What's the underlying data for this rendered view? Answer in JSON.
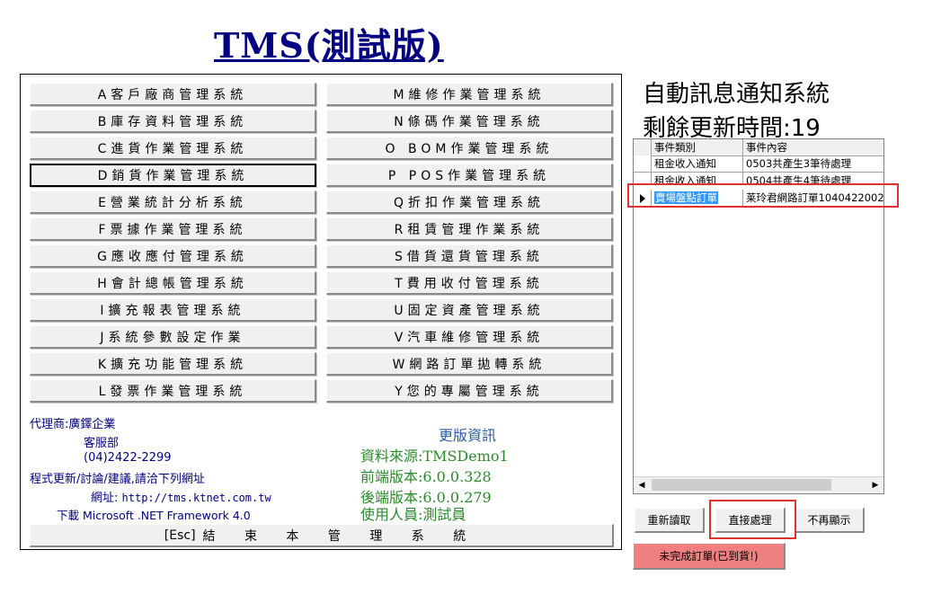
{
  "title": "TMS(測試版)",
  "menu_left": [
    "A客戶廠商管理系統",
    "B庫存資料管理系統",
    "C進貨作業管理系統",
    "D銷貨作業管理系統",
    "E營業統計分析系統",
    "F票據作業管理系統",
    "G應收應付管理系統",
    "H會計總帳管理系統",
    "I擴充報表管理系統",
    "J系統參數設定作業",
    "K擴充功能管理系統",
    "L發票作業管理系統"
  ],
  "menu_right": [
    "M維修作業管理系統",
    "N條碼作業管理系統",
    "O BOM作業管理系統",
    "P POS作業管理系統",
    "Q折扣作業管理系統",
    "R租賃管理作業系統",
    "S借貨還貨管理系統",
    "T費用收付管理系統",
    "U固定資產管理系統",
    "V汽車維修管理系統",
    "W網路訂單拋轉系統",
    "Y您的專屬管理系統"
  ],
  "agent": {
    "label": "代理商:",
    "company": "廣鐸企業",
    "dept": "客服部",
    "phone": "(04)2422-2299",
    "feedback": "程式更新/討論/建議,請洽下列網址",
    "url_label": "網址:",
    "url": "http://tms.ktnet.com.tw",
    "download": "下載 Microsoft .NET Framework 4.0"
  },
  "version_info": {
    "link": "更版資訊",
    "source": "資料來源:TMSDemo1",
    "frontend": "前端版本:6.0.0.328",
    "backend": "後端版本:6.0.0.279",
    "user": "使用人員:測試員"
  },
  "exit": {
    "key": "[Esc]",
    "label": "結 束 本 管 理 系 統"
  },
  "notify": {
    "title": "自動訊息通知系統",
    "countdown": "剩餘更新時間:19",
    "col_type": "事件類別",
    "col_content": "事件內容",
    "rows": [
      {
        "type": "租金收入通知",
        "content": "0503共產生3筆待處理"
      },
      {
        "type": "租金收入通知",
        "content": "0504共產生4筆待處理"
      },
      {
        "type": "賣場盤點訂單",
        "content": "莱玲君網路訂單1040422002"
      }
    ]
  },
  "buttons": {
    "reload": "重新讀取",
    "process": "直接處理",
    "hide": "不再顯示",
    "pending": "未完成訂單(已到貨!)"
  },
  "colors": {
    "navy": "#000080",
    "green": "#2a8a2a",
    "highlight": "#3399ff",
    "alert_red": "#e03030",
    "pending_bg": "#f08080"
  }
}
